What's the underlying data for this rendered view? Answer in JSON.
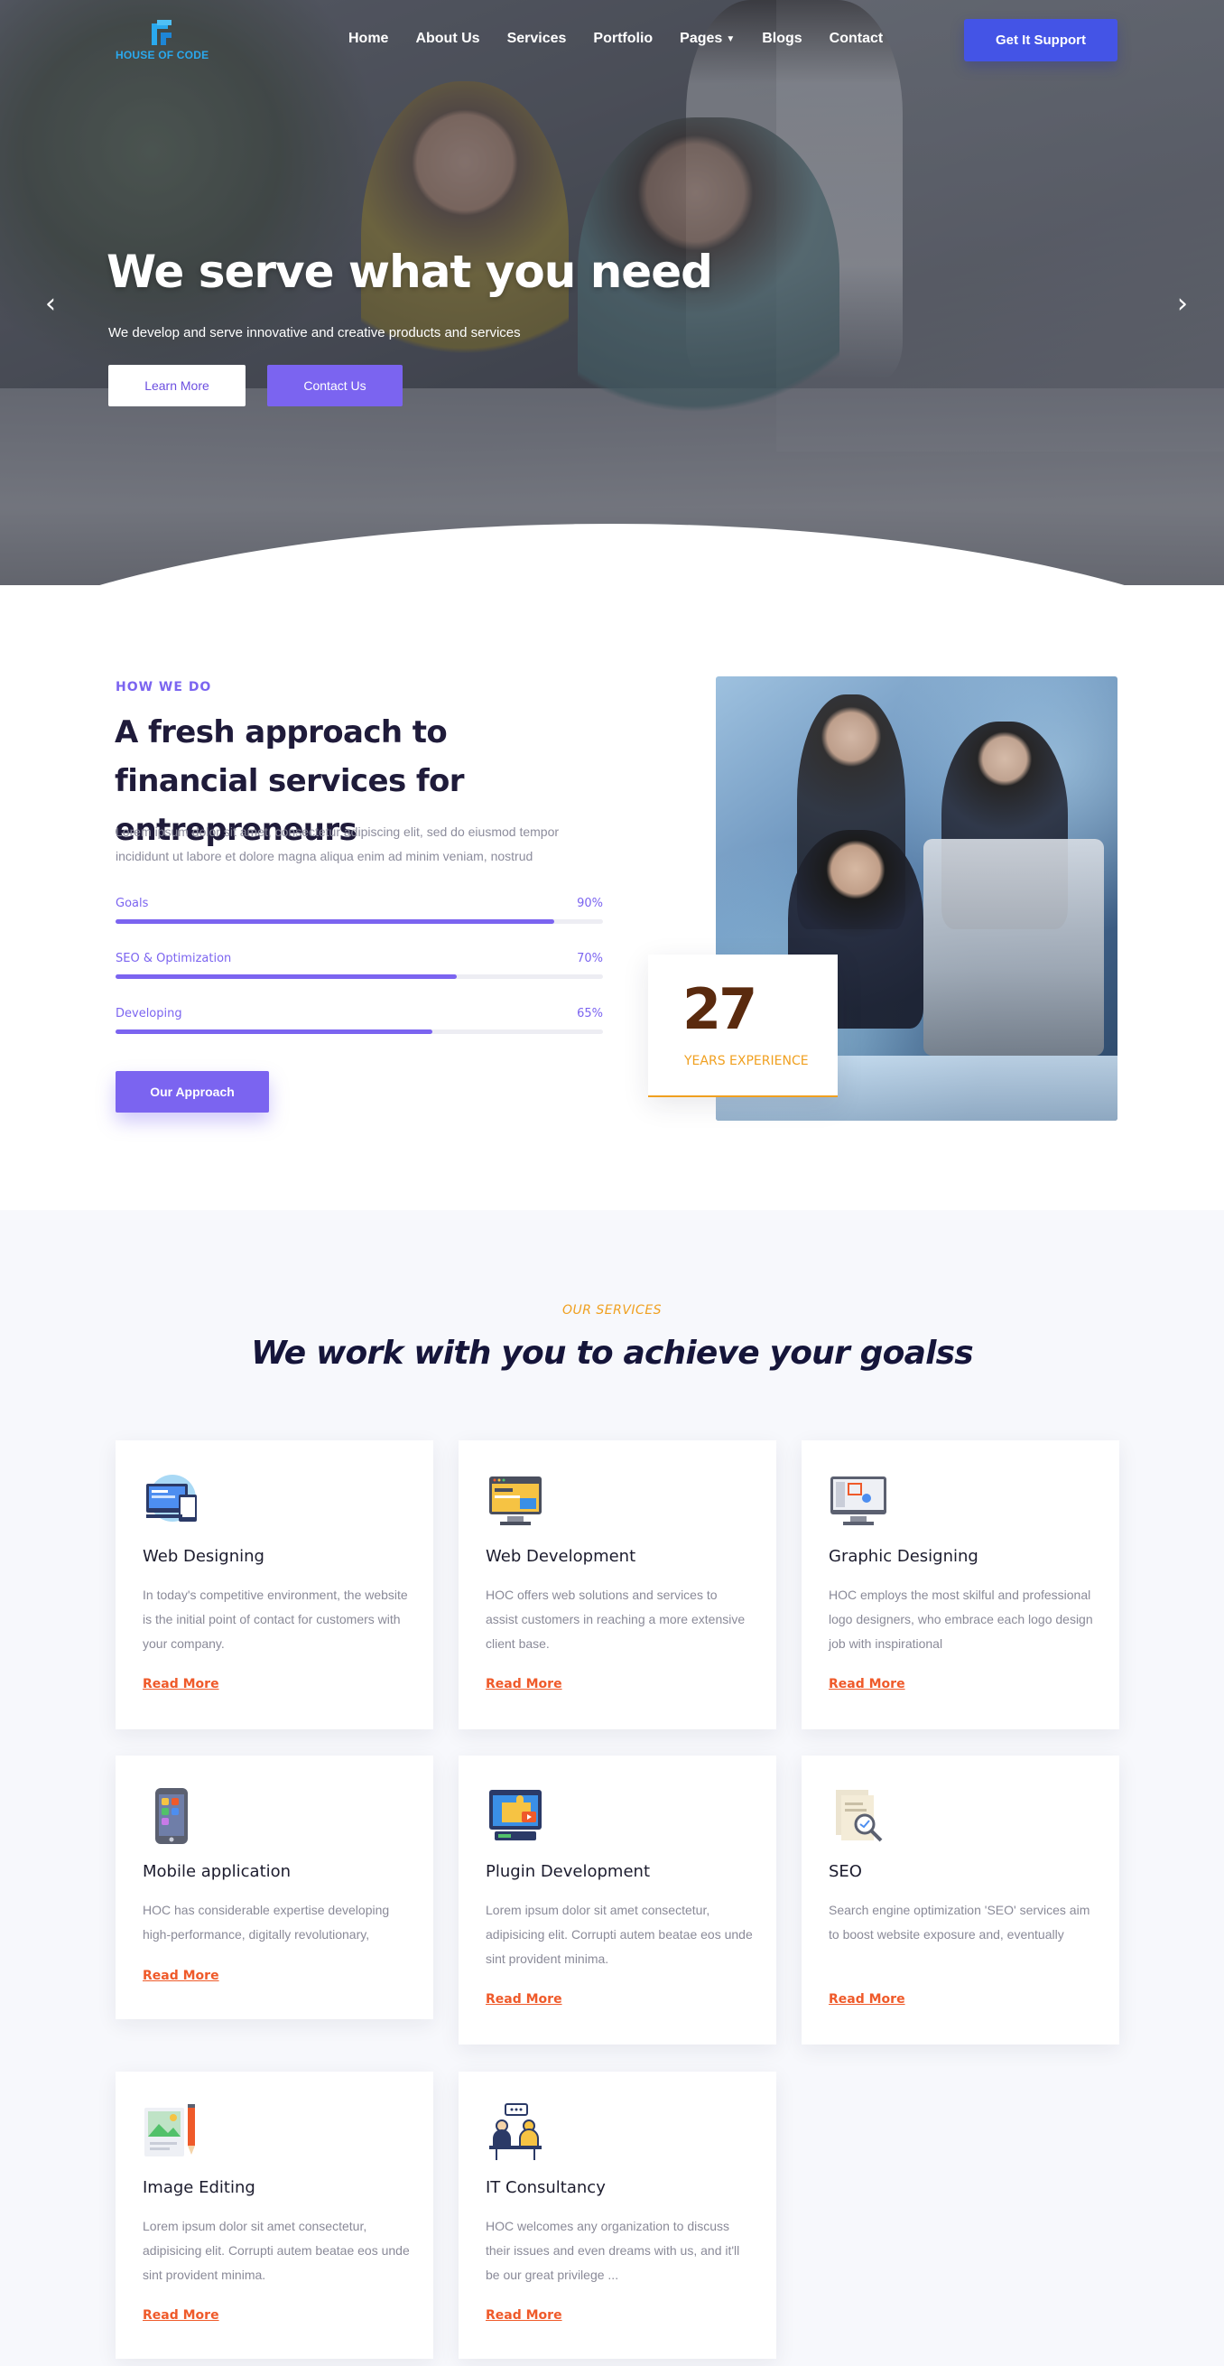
{
  "nav": {
    "logo_text": "HOUSE OF CODE",
    "links": [
      "Home",
      "About Us",
      "Services",
      "Portfolio",
      "Pages",
      "Blogs",
      "Contact"
    ],
    "cta": "Get It Support"
  },
  "hero": {
    "title": "We serve what you need",
    "subtitle": "We develop and serve innovative and creative products and services",
    "btn_learn": "Learn More",
    "btn_contact": "Contact Us",
    "slide_active": 2,
    "slide_count": 3
  },
  "about": {
    "eyebrow": "HOW WE DO",
    "title": "A fresh approach to financial services for entrepreneurs",
    "text": "Lorem ipsum dolor sit amet, consectetur adipiscing elit, sed do eiusmod tempor incididunt ut labore et dolore magna aliqua enim ad minim veniam, nostrud",
    "skills": [
      {
        "label": "Goals",
        "percent": 90,
        "percent_text": "90%"
      },
      {
        "label": "SEO & Optimization",
        "percent": 70,
        "percent_text": "70%"
      },
      {
        "label": "Developing",
        "percent": 65,
        "percent_text": "65%"
      }
    ],
    "button": "Our Approach",
    "experience_number": "27",
    "experience_label": "YEARS EXPERIENCE"
  },
  "services": {
    "eyebrow": "OUR SERVICES",
    "title": "We work with you to achieve your goalss",
    "cards": [
      {
        "title": "Web Designing",
        "text": "In today's competitive environment, the website is the initial point of contact for customers with your company.",
        "link": "Read More",
        "icon": "web-design-icon"
      },
      {
        "title": "Web Development",
        "text": "HOC offers web solutions and services to assist customers in reaching a more extensive client base.",
        "link": "Read More",
        "icon": "web-development-icon"
      },
      {
        "title": "Graphic Designing",
        "text": "HOC employs the most skilful and professional logo designers, who embrace each logo design job with inspirational",
        "link": "Read More",
        "icon": "graphic-design-icon"
      },
      {
        "title": "Mobile application",
        "text": "HOC has considerable expertise developing high-performance, digitally revolutionary,",
        "link": "Read More",
        "icon": "mobile-app-icon"
      },
      {
        "title": "Plugin Development",
        "text": "Lorem ipsum dolor sit amet consectetur, adipisicing elit. Corrupti autem beatae eos unde sint provident minima.",
        "link": "Read More",
        "icon": "plugin-icon"
      },
      {
        "title": "SEO",
        "text": "Search engine optimization 'SEO' services aim to boost website exposure and, eventually",
        "link": "Read More",
        "icon": "seo-icon"
      },
      {
        "title": "Image Editing",
        "text": "Lorem ipsum dolor sit amet consectetur, adipisicing elit. Corrupti autem beatae eos unde sint provident minima.",
        "link": "Read More",
        "icon": "image-editing-icon"
      },
      {
        "title": "IT Consultancy",
        "text": "HOC welcomes any organization to discuss their issues and even dreams with us, and it'll be our great privilege ...",
        "link": "Read More",
        "icon": "consultancy-icon"
      }
    ]
  },
  "colors": {
    "brand_blue": "#4454e6",
    "accent_purple": "#7b64f0",
    "accent_orange": "#f0a020",
    "link_red": "#ef5a2a",
    "logo_cyan": "#2aa9ee"
  }
}
